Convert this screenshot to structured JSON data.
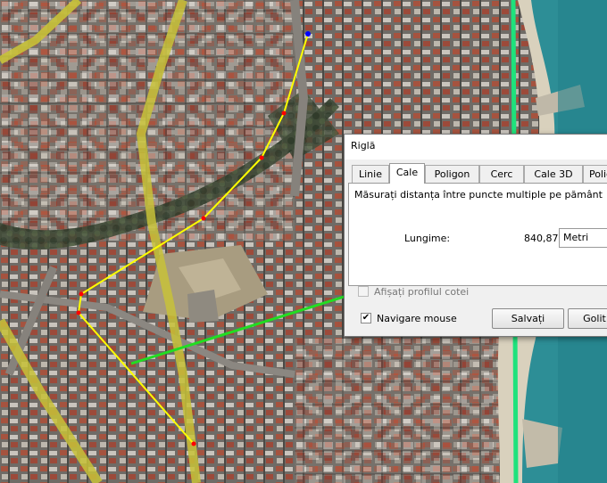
{
  "dialog": {
    "title": "Riglă",
    "tabs": [
      "Linie",
      "Cale",
      "Poligon",
      "Cerc",
      "Cale 3D",
      "Polig"
    ],
    "active_tab": "Cale",
    "description": "Măsurați distanța între puncte multiple pe pământ",
    "length_label": "Lungime:",
    "length_value": "840,87",
    "units": "Metri",
    "show_profile_label": "Afișați profilul cotei",
    "show_profile_checked": false,
    "mouse_nav_label": "Navigare mouse",
    "mouse_nav_checked": true,
    "save_label": "Salvați",
    "clear_label": "Golit"
  },
  "map": {
    "path_color": "#ffff00",
    "arrow_color": "#22dd22",
    "road_color": "#c8c238",
    "coast_line_color": "#1ee27c",
    "sea_color": "#2d8e96"
  }
}
